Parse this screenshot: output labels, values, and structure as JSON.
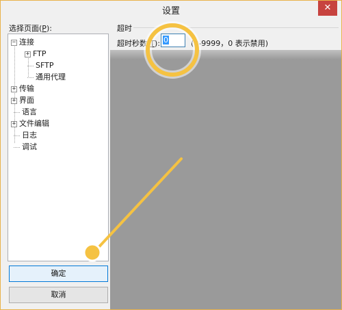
{
  "window": {
    "title": "设置",
    "close_glyph": "✕"
  },
  "left": {
    "label_prefix": "选择页面(",
    "label_key": "P",
    "label_suffix": "):",
    "tree": {
      "connection": "连接",
      "ftp": "FTP",
      "sftp": "SFTP",
      "proxy": "通用代理",
      "transfer": "传输",
      "interface": "界面",
      "language": "语言",
      "editing": "文件编辑",
      "log": "日志",
      "debug": "调试"
    },
    "expander_minus": "−",
    "expander_plus": "+"
  },
  "buttons": {
    "ok": "确定",
    "cancel": "取消"
  },
  "timeout": {
    "section_title": "超时",
    "label_prefix": "超时秒数(",
    "label_key": "T",
    "label_suffix": "):",
    "value": "0",
    "hint": "(0-9999，0 表示禁用)"
  },
  "colors": {
    "highlight_ring": "#f5c242",
    "accent": "#0078d7"
  }
}
